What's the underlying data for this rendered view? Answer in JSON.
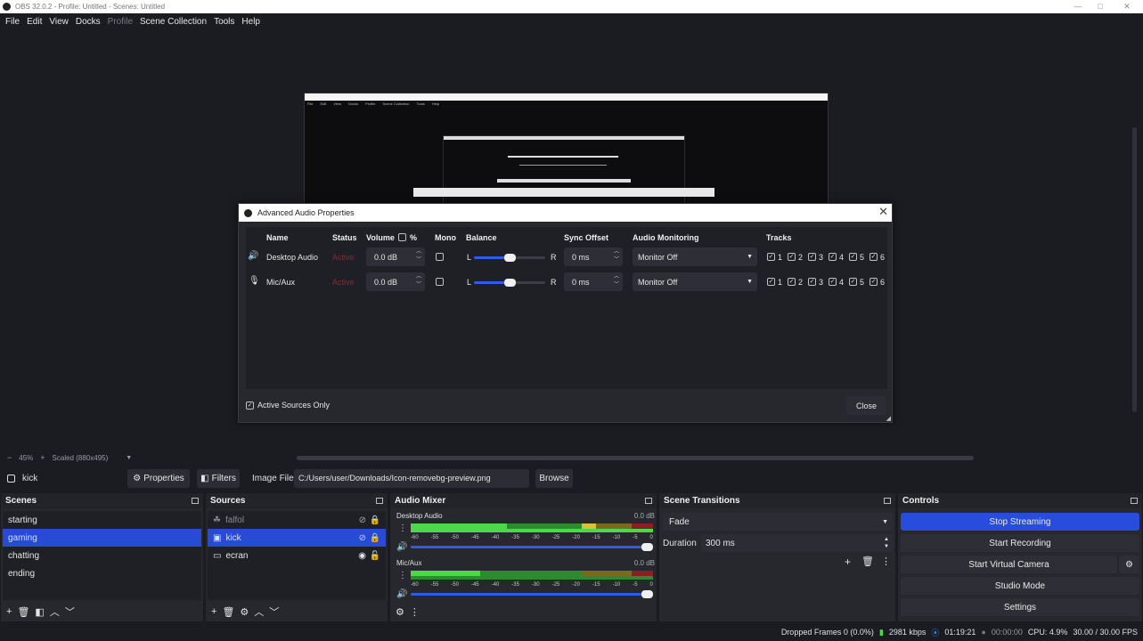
{
  "window": {
    "title": "OBS 32.0.2 - Profile: Untitled - Scenes: Untitled",
    "minimize": "—",
    "maximize": "□",
    "close": "✕"
  },
  "menu": [
    "File",
    "Edit",
    "View",
    "Docks",
    "Profile",
    "Scene Collection",
    "Tools",
    "Help"
  ],
  "preview_bar": {
    "zoom": "45%",
    "scale": "Scaled (880x495)"
  },
  "context_bar": {
    "source": "kick",
    "properties": "Properties",
    "filters": "Filters",
    "image_file_label": "Image File",
    "image_path": "C:/Users/user/Downloads/Icon-removebg-preview.png",
    "browse": "Browse"
  },
  "scenes": {
    "title": "Scenes",
    "items": [
      "starting",
      "gaming",
      "chatting",
      "ending"
    ],
    "selected": "gaming"
  },
  "sources": {
    "title": "Sources",
    "items": [
      {
        "name": "falfol",
        "icon": "paw-icon",
        "state": "hidden"
      },
      {
        "name": "kick",
        "icon": "image-icon",
        "state": "selected"
      },
      {
        "name": "ecran",
        "icon": "monitor-icon",
        "state": "visible"
      }
    ]
  },
  "audio_mixer": {
    "title": "Audio Mixer",
    "channels": [
      {
        "name": "Desktop Audio",
        "level": "0.0 dB"
      },
      {
        "name": "Mic/Aux",
        "level": "0.0 dB"
      }
    ],
    "ticks": [
      "-60",
      "-55",
      "-50",
      "-45",
      "-40",
      "-35",
      "-30",
      "-25",
      "-20",
      "-15",
      "-10",
      "-5",
      "0"
    ]
  },
  "scene_transitions": {
    "title": "Scene Transitions",
    "transition": "Fade",
    "duration_label": "Duration",
    "duration": "300 ms"
  },
  "controls": {
    "title": "Controls",
    "buttons": [
      "Stop Streaming",
      "Start Recording",
      "Start Virtual Camera",
      "Studio Mode",
      "Settings"
    ]
  },
  "status": {
    "dropped": "Dropped Frames 0 (0.0%)",
    "kbps": "2981 kbps",
    "stream_time": "01:19:21",
    "rec_time": "00:00:00",
    "cpu": "CPU: 4.9%",
    "fps": "30.00 / 30.00 FPS"
  },
  "dialog": {
    "title": "Advanced Audio Properties",
    "headers": {
      "name": "Name",
      "status": "Status",
      "volume": "Volume",
      "pct": "%",
      "mono": "Mono",
      "balance": "Balance",
      "sync": "Sync Offset",
      "monitoring": "Audio Monitoring",
      "tracks": "Tracks"
    },
    "balance_l": "L",
    "balance_r": "R",
    "rows": [
      {
        "name": "Desktop Audio",
        "icon": "speaker-icon",
        "status": "Active",
        "volume": "0.0 dB",
        "sync": "0 ms",
        "monitoring": "Monitor Off",
        "tracks": [
          "1",
          "2",
          "3",
          "4",
          "5",
          "6"
        ]
      },
      {
        "name": "Mic/Aux",
        "icon": "microphone-icon",
        "status": "Active",
        "volume": "0.0 dB",
        "sync": "0 ms",
        "monitoring": "Monitor Off",
        "tracks": [
          "1",
          "2",
          "3",
          "4",
          "5",
          "6"
        ]
      }
    ],
    "active_only": "Active Sources Only",
    "close": "Close"
  },
  "colors": {
    "accent": "#284cdc",
    "selected": "#274bd4",
    "active_status": "#d8323f",
    "meter_green": "#4cd84a",
    "meter_yellow": "#d8c03a",
    "meter_red": "#d83a3a"
  }
}
